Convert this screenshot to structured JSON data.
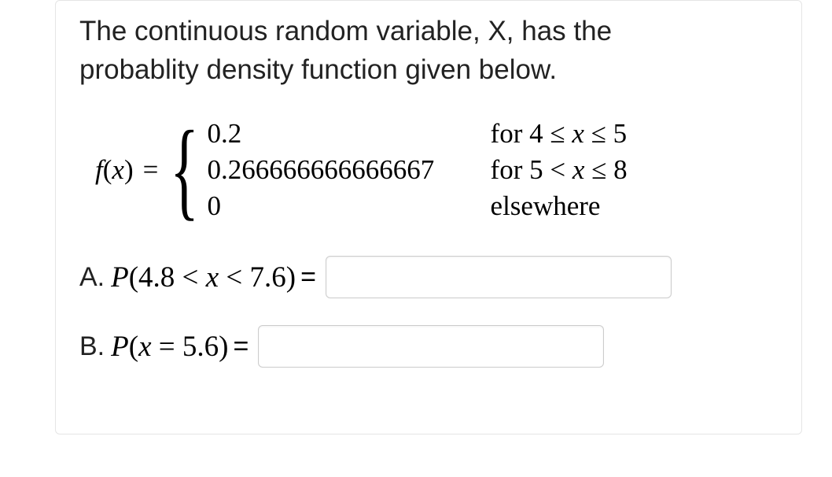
{
  "intro_line1": "The continuous random variable, X, has the",
  "intro_line2": "probablity density function given below.",
  "piecewise": {
    "lhs": "f(x)",
    "equals": "=",
    "cases": [
      {
        "value": "0.2",
        "condition_prefix": "for ",
        "condition_math": "4 ≤ x ≤ 5"
      },
      {
        "value": "0.266666666666667",
        "condition_prefix": "for ",
        "condition_math": "5 < x ≤ 8"
      },
      {
        "value": "0",
        "condition_prefix": "",
        "condition_math": "elsewhere"
      }
    ]
  },
  "questions": {
    "a": {
      "label": "A.",
      "expr_html": "P(4.8 < x < 7.6)",
      "eq": "="
    },
    "b": {
      "label": "B.",
      "expr_html": "P(x = 5.6)",
      "eq": "="
    }
  }
}
